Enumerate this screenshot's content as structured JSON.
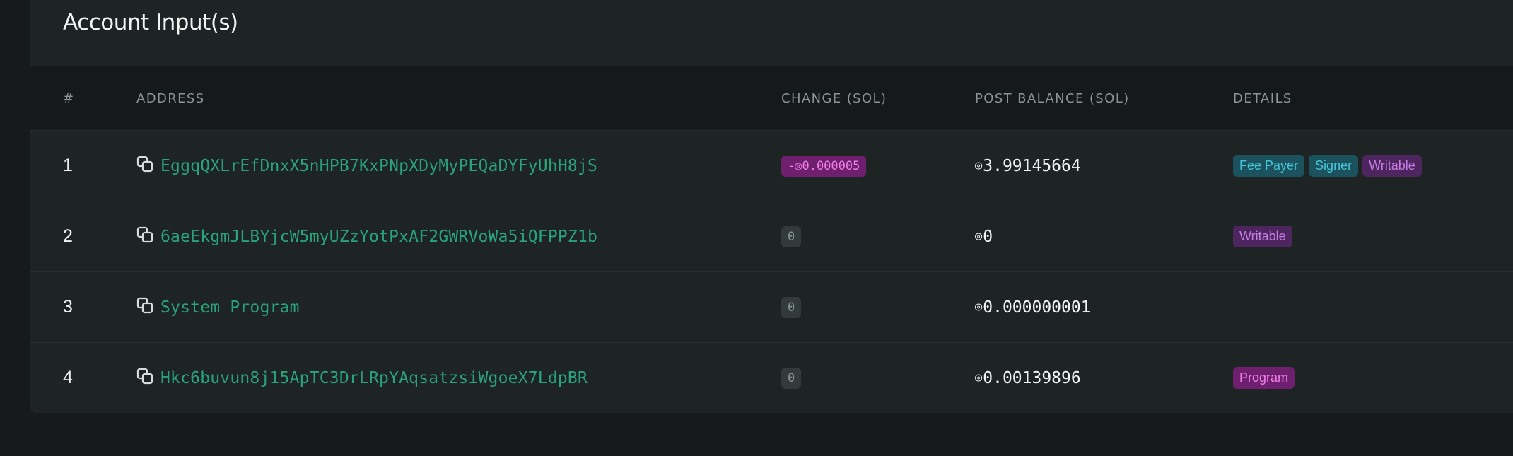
{
  "card": {
    "title": "Account Input(s)"
  },
  "table": {
    "columns": {
      "index": "#",
      "address": "ADDRESS",
      "change": "CHANGE (SOL)",
      "post_balance": "POST BALANCE (SOL)",
      "details": "DETAILS"
    },
    "sol_symbol": "◎",
    "rows": [
      {
        "index": "1",
        "address": "EggqQXLrEfDnxX5nHPB7KxPNpXDyMyPEQaDYFyUhH8jS",
        "change": "-◎0.000005",
        "change_type": "negative",
        "post_balance": "3.99145664",
        "details": [
          "Fee Payer",
          "Signer",
          "Writable"
        ]
      },
      {
        "index": "2",
        "address": "6aeEkgmJLBYjcW5myUZzYotPxAF2GWRVoWa5iQFPPZ1b",
        "change": "0",
        "change_type": "zero",
        "post_balance": "0",
        "details": [
          "Writable"
        ]
      },
      {
        "index": "3",
        "address": "System Program",
        "change": "0",
        "change_type": "zero",
        "post_balance": "0.000000001",
        "details": []
      },
      {
        "index": "4",
        "address": "Hkc6buvun8j15ApTC3DrLRpYAqsatzsiWgoeX7LdpBR",
        "change": "0",
        "change_type": "zero",
        "post_balance": "0.00139896",
        "details": [
          "Program"
        ]
      }
    ]
  },
  "colors": {
    "page_bg": "#161a1a",
    "card_bg": "#1e2323",
    "address_link": "#29a37c",
    "badge_teal_bg": "#1c525e",
    "badge_teal_text": "#45c6d8",
    "badge_purple_bg": "#4d2660",
    "badge_purple_text": "#c77ee2",
    "badge_magenta_bg": "#6e1f6d",
    "badge_magenta_text": "#f07fe8"
  },
  "icons": {
    "copy": "copy-icon",
    "sol": "sol-icon"
  }
}
